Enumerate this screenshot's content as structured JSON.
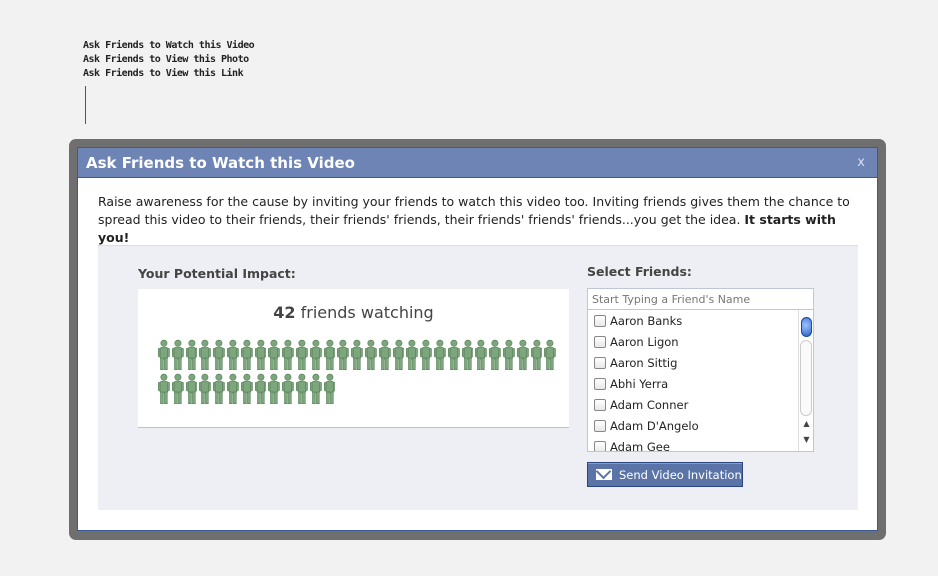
{
  "top_links": [
    "Ask Friends to Watch this Video",
    "Ask Friends to View this Photo",
    "Ask Friends to View this Link"
  ],
  "dialog": {
    "title": "Ask Friends to Watch this Video",
    "close_label": "x",
    "intro_text": "Raise awareness for the cause by inviting your friends to watch this video too. Inviting friends gives them the chance to spread this video to their friends, their friends' friends, their friends' friends' friends...you get the idea. ",
    "intro_bold": "It starts with you!"
  },
  "impact": {
    "title": "Your Potential Impact:",
    "count": "42",
    "count_suffix": " friends watching",
    "people_count": 42,
    "person_icon": "person-icon",
    "person_color": "#7ea67e"
  },
  "friends": {
    "title": "Select Friends:",
    "placeholder": "Start Typing a Friend's Name",
    "items": [
      "Aaron Banks",
      "Aaron Ligon",
      "Aaron Sittig",
      "Abhi Yerra",
      "Adam Conner",
      "Adam D'Angelo",
      "Adam Gee"
    ]
  },
  "send_button": {
    "label": "Send Video Invitation",
    "icon": "envelope-icon"
  },
  "colors": {
    "header_bg": "#6d84b4",
    "button_bg": "#5b74a8",
    "panel_bg": "#edeff4"
  }
}
